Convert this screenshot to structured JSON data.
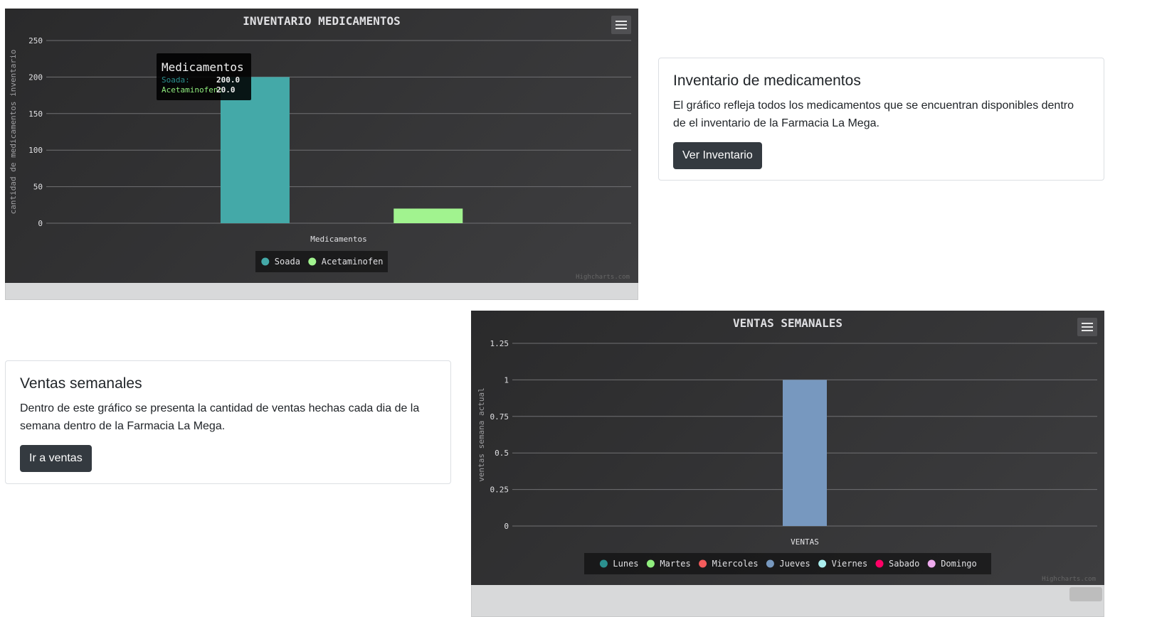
{
  "inventory_chart": {
    "menu_icon": "hamburger-menu-icon",
    "credit": "Highcharts.com",
    "tooltip": {
      "title": "Medicamentos",
      "rows": [
        {
          "name": "Soada:",
          "value": "200.0",
          "color": "#2b908f"
        },
        {
          "name": "Acetaminofen:",
          "value": "20.0",
          "color": "#90ee7e"
        }
      ]
    }
  },
  "inventory_card": {
    "title": "Inventario de medicamentos",
    "text": "El gráfico refleja todos los medicamentos que se encuentran disponibles dentro de el inventario de la Farmacia La Mega.",
    "button": "Ver Inventario"
  },
  "sales_card": {
    "title": "Ventas semanales",
    "text": "Dentro de este gráfico se presenta la cantidad de ventas hechas cada dia de la semana dentro de la Farmacia La Mega.",
    "button": "Ir a ventas"
  },
  "sales_chart": {
    "menu_icon": "hamburger-menu-icon",
    "credit": "Highcharts.com"
  },
  "chart_data": [
    {
      "type": "bar",
      "title": "INVENTARIO MEDICAMENTOS",
      "xlabel": "Medicamentos",
      "ylabel": "cantidad de medicamentos inventario",
      "ylim": [
        0,
        250
      ],
      "yticks": [
        0,
        50,
        100,
        150,
        200,
        250
      ],
      "grid": true,
      "legend_position": "bottom-center",
      "categories": [
        "Medicamentos"
      ],
      "series": [
        {
          "name": "Soada",
          "values": [
            200
          ],
          "color": "#44a9a8"
        },
        {
          "name": "Acetaminofen",
          "values": [
            20
          ],
          "color": "#a1f38f"
        }
      ]
    },
    {
      "type": "bar",
      "title": "VENTAS SEMANALES",
      "xlabel": "VENTAS",
      "ylabel": "ventas semana actual",
      "ylim": [
        0,
        1.25
      ],
      "yticks": [
        0,
        0.25,
        0.5,
        0.75,
        1,
        1.25
      ],
      "grid": true,
      "legend_position": "bottom-center",
      "categories": [
        "VENTAS"
      ],
      "series": [
        {
          "name": "Lunes",
          "values": [
            0
          ],
          "color": "#2b908f"
        },
        {
          "name": "Martes",
          "values": [
            0
          ],
          "color": "#90ee7e"
        },
        {
          "name": "Miercoles",
          "values": [
            0
          ],
          "color": "#f45b5b"
        },
        {
          "name": "Jueves",
          "values": [
            1
          ],
          "color": "#7798bf"
        },
        {
          "name": "Viernes",
          "values": [
            0
          ],
          "color": "#aaeeee"
        },
        {
          "name": "Sabado",
          "values": [
            0
          ],
          "color": "#ff0066"
        },
        {
          "name": "Domingo",
          "values": [
            0
          ],
          "color": "#eeaaee"
        }
      ]
    }
  ]
}
